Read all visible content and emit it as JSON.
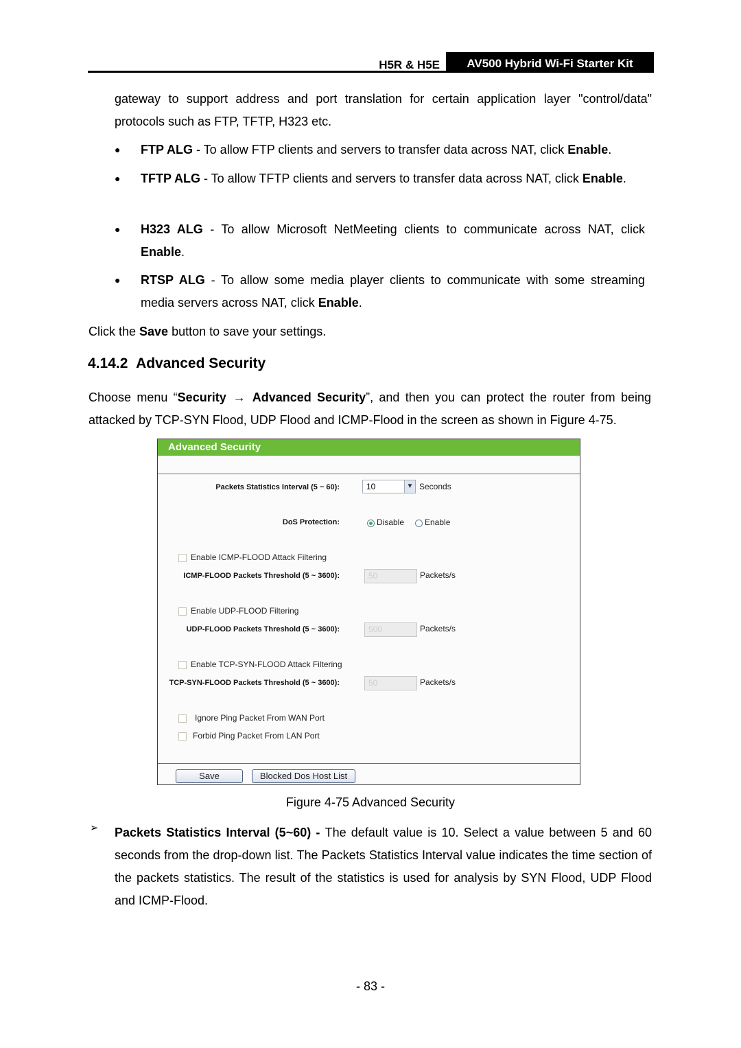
{
  "header": {
    "model": "H5R & H5E",
    "kit": "AV500 Hybrid Wi-Fi Starter Kit"
  },
  "intro": {
    "text": "gateway to support address and port translation for certain application layer \"control/data\" protocols such as FTP, TFTP, H323 etc."
  },
  "bullets": [
    {
      "term": "FTP ALG",
      "text": " - To allow FTP clients and servers to transfer data across NAT, click ",
      "action": "Enable",
      "end": "."
    },
    {
      "term": "TFTP ALG",
      "text": " - To allow TFTP clients and servers to transfer data across NAT, click ",
      "action": "Enable",
      "end": "."
    },
    {
      "term": "H323 ALG",
      "text": " - To allow Microsoft NetMeeting clients to communicate across NAT, click ",
      "action": "Enable",
      "end": "."
    },
    {
      "term": "RTSP ALG",
      "text": " - To allow some media player clients to communicate with some streaming media servers across NAT, click ",
      "action": "Enable",
      "end": "."
    }
  ],
  "save_line": {
    "pre": "Click the ",
    "bold": "Save",
    "post": " button to save your settings."
  },
  "section": {
    "number": "4.14.2",
    "title": "Advanced Security",
    "choose_pre": "Choose menu “",
    "menu1": "Security",
    "arrow": "→",
    "menu2": "Advanced Security",
    "choose_post": "”, and then you can protect the router from being attacked by TCP-SYN Flood, UDP Flood and ICMP-Flood in the screen as shown in Figure 4-75."
  },
  "panel": {
    "title": "Advanced Security",
    "interval_label": "Packets Statistics Interval (5 ~ 60):",
    "interval_value": "10",
    "interval_unit": "Seconds",
    "dos_label": "DoS Protection:",
    "dos_options": [
      "Disable",
      "Enable"
    ],
    "dos_selected": "Disable",
    "icmp_enable": "Enable ICMP-FLOOD Attack Filtering",
    "icmp_label": "ICMP-FLOOD Packets Threshold (5 ~ 3600):",
    "icmp_value": "50",
    "udp_enable": "Enable UDP-FLOOD Filtering",
    "udp_label": "UDP-FLOOD Packets Threshold (5 ~ 3600):",
    "udp_value": "500",
    "tcp_enable": "Enable TCP-SYN-FLOOD Attack Filtering",
    "tcp_label": "TCP-SYN-FLOOD Packets Threshold (5 ~ 3600):",
    "tcp_value": "50",
    "unit_pps": "Packets/s",
    "ignore_ping": "Ignore Ping Packet From WAN Port",
    "forbid_ping": "Forbid Ping Packet From LAN Port",
    "save_btn": "Save",
    "blocked_btn": "Blocked Dos Host List",
    "accent_color": "#6bbb38"
  },
  "caption": "Figure 4-75 Advanced Security",
  "description": {
    "term": "Packets Statistics Interval (5~60) - ",
    "text": "The default value is 10. Select a value between 5 and 60 seconds from the drop-down list. The Packets Statistics Interval value indicates the time section of the packets statistics. The result of the statistics is used for analysis by SYN Flood, UDP Flood and ICMP-Flood."
  },
  "page_number": "- 83 -"
}
